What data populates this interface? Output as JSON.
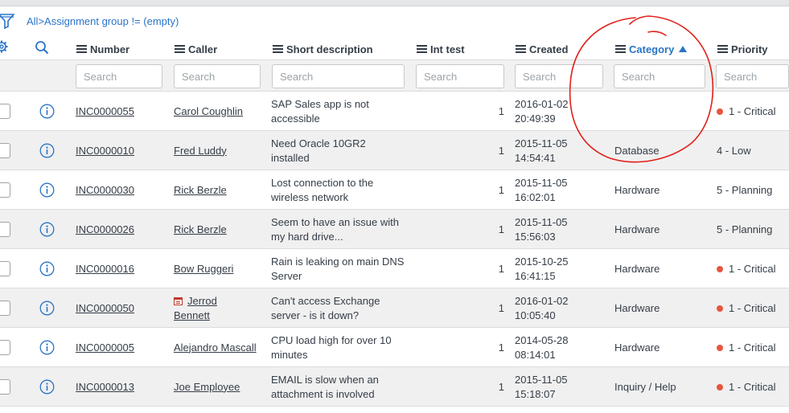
{
  "breadcrumb": {
    "all": "All",
    "sep": ">",
    "filter": "Assignment group != (empty)"
  },
  "columns": {
    "number": "Number",
    "caller": "Caller",
    "short_description": "Short description",
    "int_test": "Int test",
    "created": "Created",
    "category": "Category",
    "priority": "Priority"
  },
  "search": {
    "placeholder": "Search"
  },
  "colors": {
    "link": "#2a74c8",
    "critical_dot": "#e8553e",
    "annotation": "#e0201a"
  },
  "rows": [
    {
      "number": "INC0000055",
      "caller": "Carol Coughlin",
      "caller_l1": "",
      "caller_l2": "",
      "desc1": "SAP Sales app is not",
      "desc2": "accessible",
      "int_test": "1",
      "created1": "2016-01-02",
      "created2": "20:49:39",
      "category": "",
      "priority": "1 - Critical",
      "critical": true
    },
    {
      "number": "INC0000010",
      "caller": "Fred Luddy",
      "caller_l1": "",
      "caller_l2": "",
      "desc1": "Need Oracle 10GR2",
      "desc2": "installed",
      "int_test": "1",
      "created1": "2015-11-05",
      "created2": "14:54:41",
      "category": "Database",
      "priority": "4 - Low",
      "critical": false
    },
    {
      "number": "INC0000030",
      "caller": "Rick Berzle",
      "caller_l1": "",
      "caller_l2": "",
      "desc1": "Lost connection to the",
      "desc2": "wireless network",
      "int_test": "1",
      "created1": "2015-11-05",
      "created2": "16:02:01",
      "category": "Hardware",
      "priority": "5 - Planning",
      "critical": false
    },
    {
      "number": "INC0000026",
      "caller": "Rick Berzle",
      "caller_l1": "",
      "caller_l2": "",
      "desc1": "Seem to have an issue with",
      "desc2": "my hard drive...",
      "int_test": "1",
      "created1": "2015-11-05",
      "created2": "15:56:03",
      "category": "Hardware",
      "priority": "5 - Planning",
      "critical": false
    },
    {
      "number": "INC0000016",
      "caller": "Bow Ruggeri",
      "caller_l1": "",
      "caller_l2": "",
      "desc1": "Rain is leaking on main DNS",
      "desc2": "Server",
      "int_test": "1",
      "created1": "2015-10-25",
      "created2": "16:41:15",
      "category": "Hardware",
      "priority": "1 - Critical",
      "critical": true
    },
    {
      "number": "INC0000050",
      "caller": "",
      "caller_l1": "Jerrod",
      "caller_l2": "Bennett",
      "desc1": "Can't access Exchange",
      "desc2": "server - is it down?",
      "int_test": "1",
      "created1": "2016-01-02",
      "created2": "10:05:40",
      "category": "Hardware",
      "priority": "1 - Critical",
      "critical": true
    },
    {
      "number": "INC0000005",
      "caller": "Alejandro Mascall",
      "caller_l1": "",
      "caller_l2": "",
      "desc1": "CPU load high for over 10",
      "desc2": "minutes",
      "int_test": "1",
      "created1": "2014-05-28",
      "created2": "08:14:01",
      "category": "Hardware",
      "priority": "1 - Critical",
      "critical": true
    },
    {
      "number": "INC0000013",
      "caller": "Joe Employee",
      "caller_l1": "",
      "caller_l2": "",
      "desc1": "EMAIL is slow when an",
      "desc2": "attachment is involved",
      "int_test": "1",
      "created1": "2015-11-05",
      "created2": "15:18:07",
      "category": "Inquiry / Help",
      "priority": "1 - Critical",
      "critical": true
    }
  ]
}
